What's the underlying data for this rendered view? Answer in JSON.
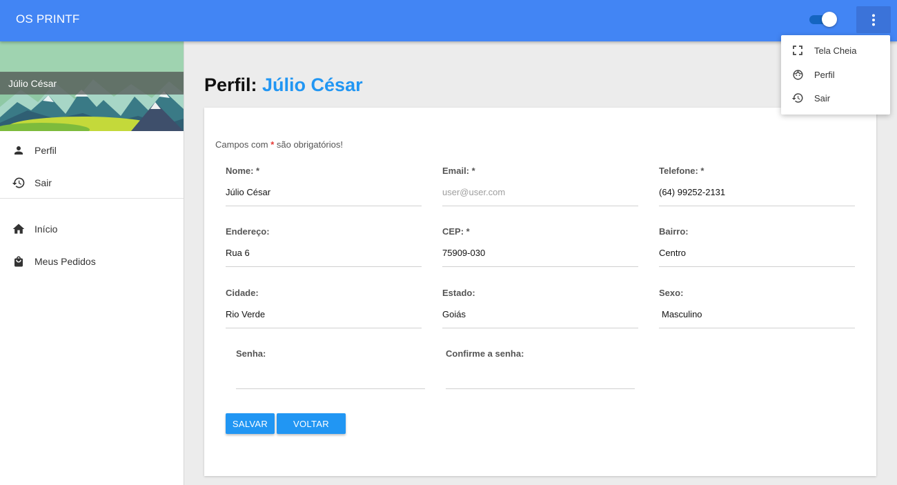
{
  "app": {
    "title": "OS PRINTF"
  },
  "topbar": {
    "theme_toggle": {
      "state": "on",
      "icon": "toggle-switch"
    },
    "more_button": {
      "icon": "more-vert-icon"
    }
  },
  "menu": {
    "items": [
      {
        "label": "Tela Cheia",
        "icon": "fullscreen-icon"
      },
      {
        "label": "Perfil",
        "icon": "face-icon"
      },
      {
        "label": "Sair",
        "icon": "history-icon"
      }
    ]
  },
  "sidebar": {
    "user_name": "Júlio César",
    "items": [
      {
        "label": "Perfil",
        "icon": "person-icon"
      },
      {
        "label": "Sair",
        "icon": "history-icon"
      },
      {
        "label": "Início",
        "icon": "home-icon"
      },
      {
        "label": "Meus Pedidos",
        "icon": "shopping-bag-icon"
      }
    ]
  },
  "page": {
    "title_prefix": "Perfil: ",
    "title_name": "Júlio César",
    "required_prefix": "Campos com ",
    "required_star": "*",
    "required_suffix": " são obrigatórios!"
  },
  "form": {
    "nome": {
      "label": "Nome: *",
      "value": "Júlio César"
    },
    "email": {
      "label": "Email: *",
      "placeholder": "user@user.com"
    },
    "telefone": {
      "label": "Telefone: *",
      "value": "(64) 99252-2131"
    },
    "endereco": {
      "label": "Endereço:",
      "value": "Rua 6"
    },
    "cep": {
      "label": "CEP: *",
      "value": "75909-030"
    },
    "bairro": {
      "label": "Bairro:",
      "value": "Centro"
    },
    "cidade": {
      "label": "Cidade:",
      "value": "Rio Verde"
    },
    "estado": {
      "label": "Estado:",
      "value": "Goiás"
    },
    "sexo": {
      "label": "Sexo:",
      "value": "Masculino"
    },
    "senha": {
      "label": "Senha:",
      "value": ""
    },
    "confirma": {
      "label": "Confirme a senha:",
      "value": ""
    }
  },
  "buttons": {
    "save": "SALVAR",
    "back": "VOLTAR"
  },
  "colors": {
    "primary": "#4285f4",
    "accent": "#2196f3",
    "required": "#e53935"
  }
}
